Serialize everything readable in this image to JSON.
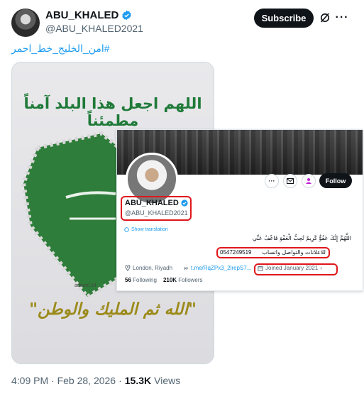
{
  "post": {
    "author_name": "ABU_KHALED",
    "author_handle": "@ABU_KHALED2021",
    "subscribe_label": "Subscribe",
    "hashtag": "#امن_الخليج_خط_احمر",
    "timestamp": "4:09 PM · Feb 28, 2026",
    "separator": "·",
    "views_count": "15.3K",
    "views_label": "Views"
  },
  "poster": {
    "title": "اللهم اجعل هذا البلد آمناً مطمئناً",
    "credit": "adeeel.14",
    "slogan": "\"الله ثم المليك والوطن\""
  },
  "profile_card": {
    "name": "ABU_KHALED",
    "handle": "@ABU_KHALED2021",
    "follow_label": "Follow",
    "translate_label": "Show translation",
    "bio_line1": "اللَّهُمَّ إِنَّكَ عَفُوٌّ كَرِيمٌ تُحِبُّ الْعَفْوَ فَاعْفُ عَنِّي",
    "bio_line2": "للاعلانات والتواصل واتساب",
    "phone": "0547249519",
    "location": "London, Riyadh",
    "link": "t.me/RqZPx3_2lrepS7...",
    "joined": "Joined January 2021",
    "following_count": "56",
    "following_label": "Following",
    "followers_count": "210K",
    "followers_label": "Followers"
  },
  "colors": {
    "accent": "#1d9bf0",
    "highlight_red": "#e0161b",
    "poster_green": "#1f7a38"
  }
}
